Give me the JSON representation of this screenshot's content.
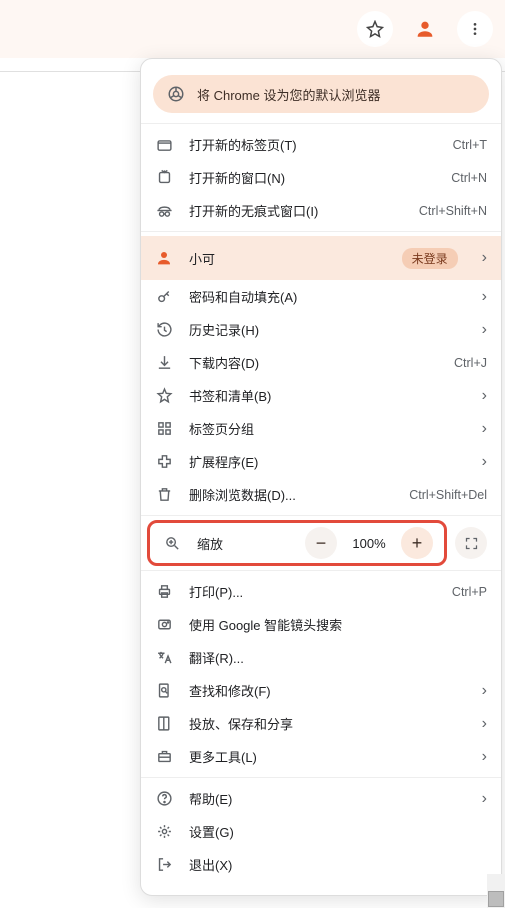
{
  "promo": {
    "text": "将 Chrome 设为您的默认浏览器"
  },
  "section_window": {
    "new_tab": {
      "label": "打开新的标签页(T)",
      "shortcut": "Ctrl+T"
    },
    "new_window": {
      "label": "打开新的窗口(N)",
      "shortcut": "Ctrl+N"
    },
    "new_incognito": {
      "label": "打开新的无痕式窗口(I)",
      "shortcut": "Ctrl+Shift+N"
    }
  },
  "profile": {
    "name": "小可",
    "status": "未登录"
  },
  "section_features": {
    "passwords": {
      "label": "密码和自动填充(A)"
    },
    "history": {
      "label": "历史记录(H)"
    },
    "downloads": {
      "label": "下载内容(D)",
      "shortcut": "Ctrl+J"
    },
    "bookmarks": {
      "label": "书签和清单(B)"
    },
    "tabgroups": {
      "label": "标签页分组"
    },
    "extensions": {
      "label": "扩展程序(E)"
    },
    "clear_data": {
      "label": "删除浏览数据(D)...",
      "shortcut": "Ctrl+Shift+Del"
    }
  },
  "zoom": {
    "label": "缩放",
    "value": "100%"
  },
  "section_tools": {
    "print": {
      "label": "打印(P)...",
      "shortcut": "Ctrl+P"
    },
    "lens": {
      "label": "使用 Google 智能镜头搜索"
    },
    "translate": {
      "label": "翻译(R)..."
    },
    "find": {
      "label": "查找和修改(F)"
    },
    "cast": {
      "label": "投放、保存和分享"
    },
    "more_tools": {
      "label": "更多工具(L)"
    }
  },
  "section_last": {
    "help": {
      "label": "帮助(E)"
    },
    "settings": {
      "label": "设置(G)"
    },
    "exit": {
      "label": "退出(X)"
    }
  }
}
